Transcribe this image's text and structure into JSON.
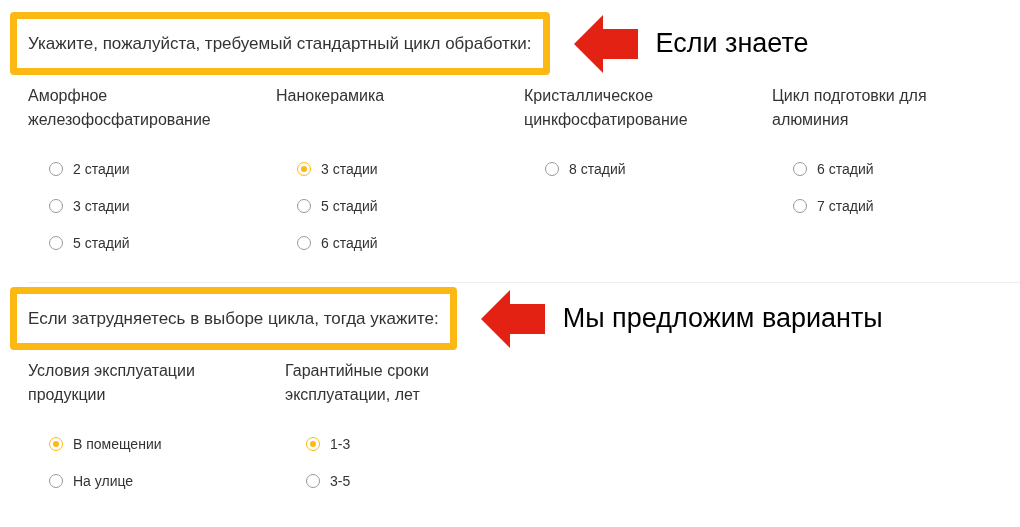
{
  "sections": [
    {
      "title": "Укажите, пожалуйста, требуемый стандартный цикл обработки:",
      "note": "Если знаете",
      "groups": [
        {
          "label": "Аморфное железофосфатирование",
          "options": [
            {
              "label": "2 стадии",
              "selected": false
            },
            {
              "label": "3 стадии",
              "selected": false
            },
            {
              "label": "5 стадий",
              "selected": false
            }
          ]
        },
        {
          "label": "Нанокерамика",
          "options": [
            {
              "label": "3 стадии",
              "selected": true
            },
            {
              "label": "5 стадий",
              "selected": false
            },
            {
              "label": "6 стадий",
              "selected": false
            }
          ]
        },
        {
          "label": "Кристаллическое цинкфосфатирование",
          "options": [
            {
              "label": "8 стадий",
              "selected": false
            }
          ]
        },
        {
          "label": "Цикл подготовки для алюминия",
          "options": [
            {
              "label": "6 стадий",
              "selected": false
            },
            {
              "label": "7 стадий",
              "selected": false
            }
          ]
        }
      ]
    },
    {
      "title": "Если затрудняетесь в выборе цикла, тогда укажите:",
      "note": "Мы предложим варианты",
      "groups": [
        {
          "label": "Условия эксплуатации продукции",
          "options": [
            {
              "label": "В помещении",
              "selected": true
            },
            {
              "label": "На улице",
              "selected": false
            }
          ]
        },
        {
          "label": "Гарантийные сроки эксплуатации, лет",
          "options": [
            {
              "label": "1-3",
              "selected": true
            },
            {
              "label": "3-5",
              "selected": false
            }
          ]
        }
      ]
    }
  ]
}
